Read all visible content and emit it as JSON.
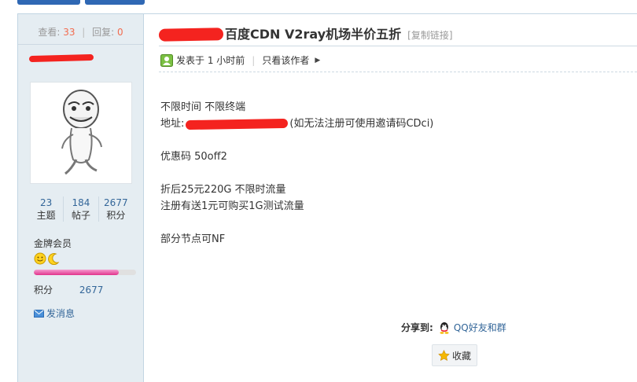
{
  "stats": {
    "views_label": "查看:",
    "views": "33",
    "replies_label": "回复:",
    "replies": "0"
  },
  "author": {
    "counts": [
      {
        "value": "23",
        "label": "主题"
      },
      {
        "value": "184",
        "label": "帖子"
      },
      {
        "value": "2677",
        "label": "积分"
      }
    ],
    "rank": "金牌会员",
    "progress": 0.83,
    "score_label": "积分",
    "score_value": "2677",
    "send_message": "发消息"
  },
  "post": {
    "title": "百度CDN V2ray机场半价五折",
    "copy_link": "[复制链接]",
    "posted": "发表于 1 小时前",
    "only_author": "只看该作者",
    "lines": {
      "l1": "不限时间 不限终端",
      "l2_prefix": "地址:",
      "l2_suffix": "(如无法注册可使用邀请码CDci)",
      "l3": "优惠码 50off2",
      "l4": "折后25元220G 不限时流量",
      "l5": "注册有送1元可购买1G测试流量",
      "l6": "部分节点可NF"
    }
  },
  "share": {
    "label": "分享到:",
    "qq": "QQ好友和群"
  },
  "favorite": {
    "label": "收藏"
  },
  "colors": {
    "accent": "#336699",
    "highlight": "#f26c4f",
    "redact": "#f4231f",
    "sidebar": "#e5edf2"
  },
  "icons": [
    "user-online-icon",
    "arrow-right-icon",
    "envelope-icon",
    "qq-icon",
    "star-icon",
    "medal-icon"
  ]
}
